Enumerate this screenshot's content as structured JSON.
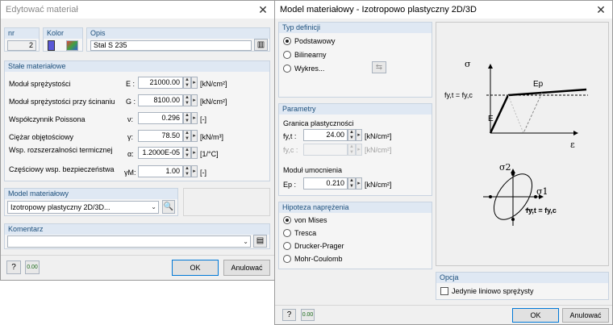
{
  "left": {
    "title": "Edytować materiał",
    "hdr_nr": "nr",
    "nr_value": "2",
    "hdr_kolor": "Kolor",
    "hdr_opis": "Opis",
    "opis_value": "Stal S 235",
    "stale_title": "Stałe materiałowe",
    "rows": [
      {
        "label": "Moduł sprężystości",
        "symbol": "E :",
        "value": "21000.00",
        "unit": "[kN/cm²]"
      },
      {
        "label": "Moduł sprężystości przy ścinaniu",
        "symbol": "G :",
        "value": "8100.00",
        "unit": "[kN/cm²]"
      },
      {
        "label": "Współczynnik Poissona",
        "symbol": "ν:",
        "value": "0.296",
        "unit": "[-]"
      },
      {
        "label": "Ciężar objętościowy",
        "symbol": "γ:",
        "value": "78.50",
        "unit": "[kN/m³]"
      },
      {
        "label": "Wsp. rozszerzalności termicznej",
        "symbol": "α:",
        "value": "1.2000E-05",
        "unit": "[1/°C]"
      },
      {
        "label": "Częściowy wsp. bezpieczeństwa",
        "symbol": "γM:",
        "value": "1.00",
        "unit": "[-]"
      }
    ],
    "model_title": "Model materiałowy",
    "model_value": "Izotropowy plastyczny 2D/3D...",
    "komentarz_title": "Komentarz",
    "komentarz_value": "",
    "ok": "OK",
    "cancel": "Anulować",
    "color_swatch": "#5b59d6"
  },
  "right": {
    "title": "Model materiałowy - Izotropowo plastyczny 2D/3D",
    "typ_title": "Typ definicji",
    "typ_options": [
      "Podstawowy",
      "Bilinearny",
      "Wykres..."
    ],
    "typ_selected": 0,
    "param_title": "Parametry",
    "granica_label": "Granica plastyczności",
    "fyt_label": "fy,t :",
    "fyt_value": "24.00",
    "fyc_label": "fy,c :",
    "fyc_value": "",
    "unit1": "[kN/cm²]",
    "unit2": "[kN/cm²]",
    "modul_label": "Moduł umocnienia",
    "ep_label": "Ep :",
    "ep_value": "0.210",
    "unit3": "[kN/cm²]",
    "hipoteza_title": "Hipoteza naprężenia",
    "hipoteza_options": [
      "von Mises",
      "Tresca",
      "Drucker-Prager",
      "Mohr-Coulomb"
    ],
    "hipoteza_selected": 0,
    "diagram": {
      "sigma": "σ",
      "epsilon": "ε",
      "ep": "Ep",
      "e": "E",
      "fyt_fyc": "fy,t = fy,c",
      "sigma1": "σ1",
      "sigma2": "σ2"
    },
    "opcja_title": "Opcja",
    "opcja_check": "Jedynie liniowo sprężysty",
    "ok": "OK",
    "cancel": "Anulować"
  }
}
